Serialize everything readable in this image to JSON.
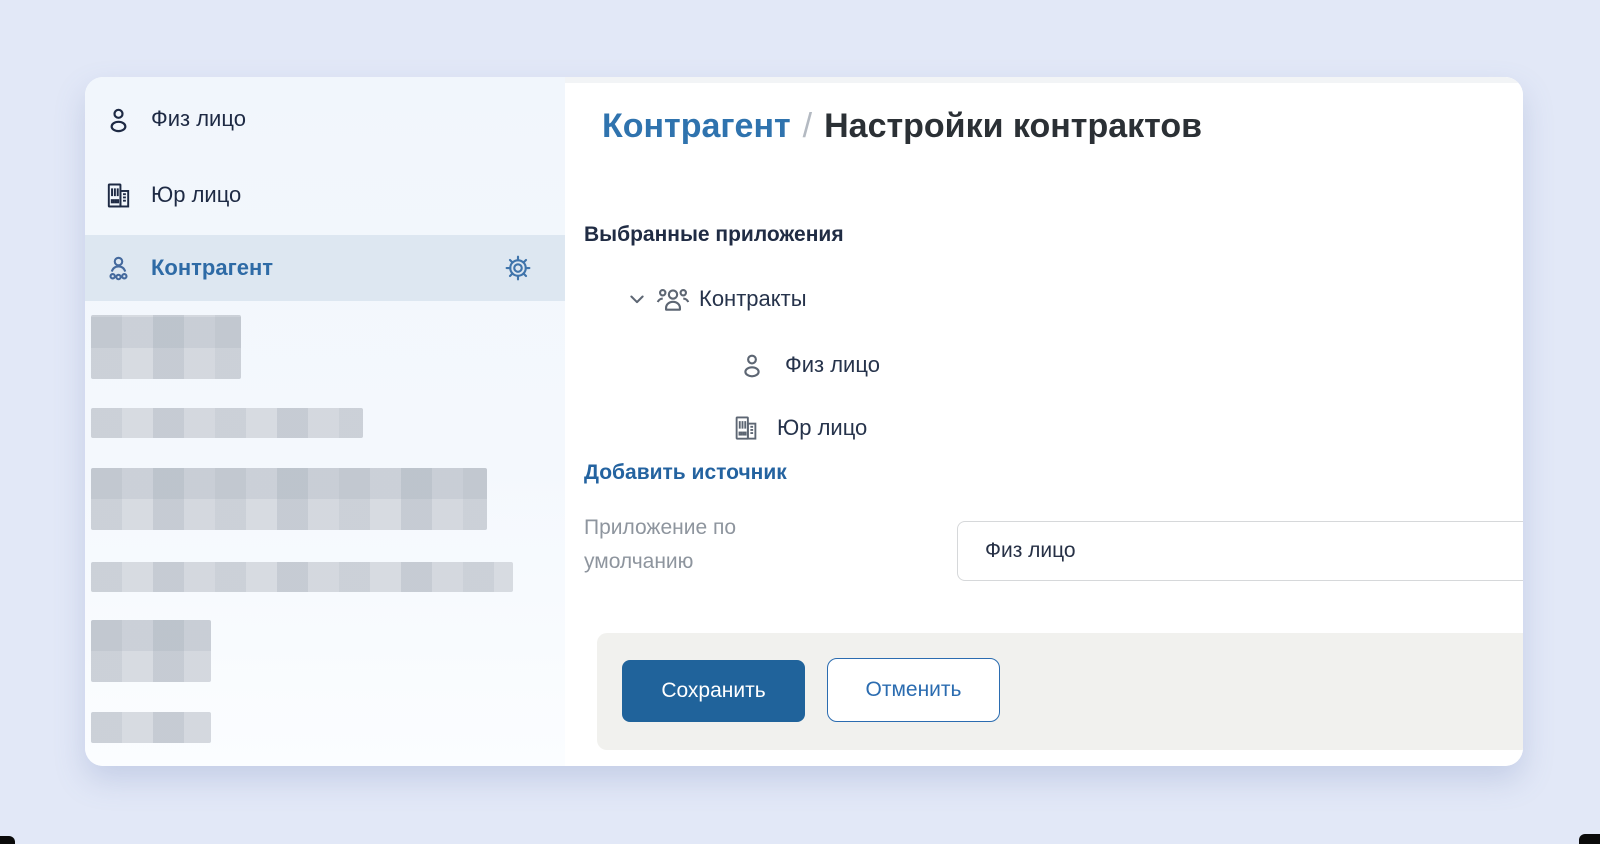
{
  "sidebar": {
    "items": [
      {
        "icon": "person-icon",
        "label": "Физ лицо"
      },
      {
        "icon": "building-icon",
        "label": "Юр лицо"
      },
      {
        "icon": "counterparty-icon",
        "label": "Контрагент",
        "selected": true,
        "trailing_icon": "gear-icon"
      }
    ],
    "redacted_items_count": 6
  },
  "breadcrumb": {
    "parent": "Контрагент",
    "separator": "/",
    "current": "Настройки контрактов"
  },
  "selected_apps": {
    "title": "Выбранные приложения",
    "tree": {
      "root": {
        "icon": "group-icon",
        "label": "Контракты",
        "expanded": true
      },
      "children": [
        {
          "icon": "person-icon",
          "label": "Физ лицо"
        },
        {
          "icon": "building-icon",
          "label": "Юр лицо"
        }
      ]
    }
  },
  "add_source": {
    "label": "Добавить источник"
  },
  "default_app": {
    "label": "Приложение по умолчанию",
    "value": "Физ лицо"
  },
  "actions": {
    "save": "Сохранить",
    "cancel": "Отменить"
  },
  "colors": {
    "page_bg": "#e2e8f7",
    "panel_bg": "#ffffff",
    "sidebar_bg": "#f2f6fb",
    "selected_row_bg": "#dde7f1",
    "header_blue": "#2f73ae",
    "link_blue": "#2463a0",
    "primary_button": "#20639b",
    "secondary_button_border": "#2b6cb0",
    "footer_bg": "#f1f1ee",
    "label_gray": "#8e959e",
    "text_dark": "#26334b"
  }
}
